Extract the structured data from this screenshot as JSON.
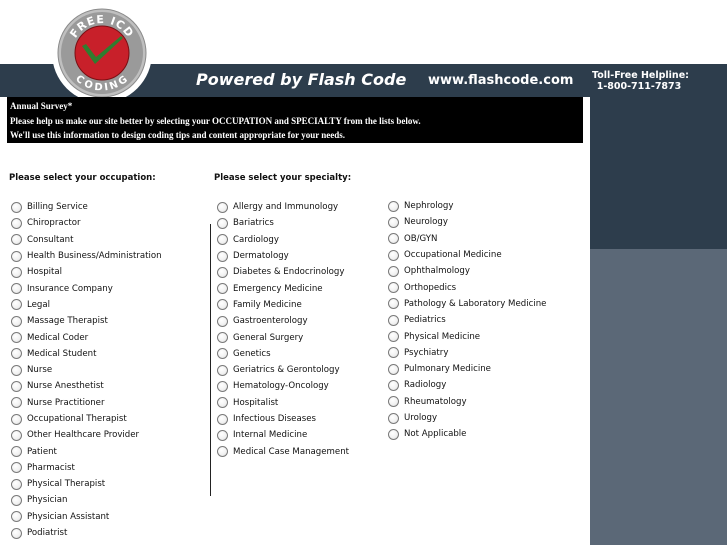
{
  "brand": {
    "logo_top_text": "FREE ICD",
    "logo_bottom_text": "CODING",
    "tagline": "Powered by Flash Code",
    "url": "www.flashcode.com",
    "helpline_label": "Toll-Free Helpline:",
    "helpline_number": "1-800-711-7873"
  },
  "colors": {
    "header_band": "#2d3d4c",
    "right_panel_lower": "#5b6877",
    "logo_red": "#c8202a",
    "logo_green": "#2f7d2f"
  },
  "survey": {
    "title": "Annual Survey*",
    "line1": "Please help us make our site better by selecting your OCCUPATION and SPECIALTY from the lists below.",
    "line2": "We'll use this information to design coding tips and content appropriate for your needs.",
    "occupation_heading": "Please select your occupation:",
    "specialty_heading": "Please select your specialty:",
    "occupations": [
      "Billing Service",
      "Chiropractor",
      "Consultant",
      "Health Business/Administration",
      "Hospital",
      "Insurance Company",
      "Legal",
      "Massage Therapist",
      "Medical Coder",
      "Medical Student",
      "Nurse",
      "Nurse Anesthetist",
      "Nurse Practitioner",
      "Occupational Therapist",
      "Other Healthcare Provider",
      "Patient",
      "Pharmacist",
      "Physical Therapist",
      "Physician",
      "Physician Assistant",
      "Podiatrist"
    ],
    "specialties_col1": [
      "Allergy and Immunology",
      "Bariatrics",
      "Cardiology",
      "Dermatology",
      "Diabetes & Endocrinology",
      "Emergency Medicine",
      "Family Medicine",
      "Gastroenterology",
      "General Surgery",
      "Genetics",
      "Geriatrics & Gerontology",
      "Hematology-Oncology",
      "Hospitalist",
      "Infectious Diseases",
      "Internal Medicine",
      "Medical Case Management"
    ],
    "specialties_col2": [
      "Nephrology",
      "Neurology",
      "OB/GYN",
      "Occupational Medicine",
      "Ophthalmology",
      "Orthopedics",
      "Pathology & Laboratory Medicine",
      "Pediatrics",
      "Physical Medicine",
      "Psychiatry",
      "Pulmonary Medicine",
      "Radiology",
      "Rheumatology",
      "Urology",
      "Not Applicable"
    ]
  }
}
